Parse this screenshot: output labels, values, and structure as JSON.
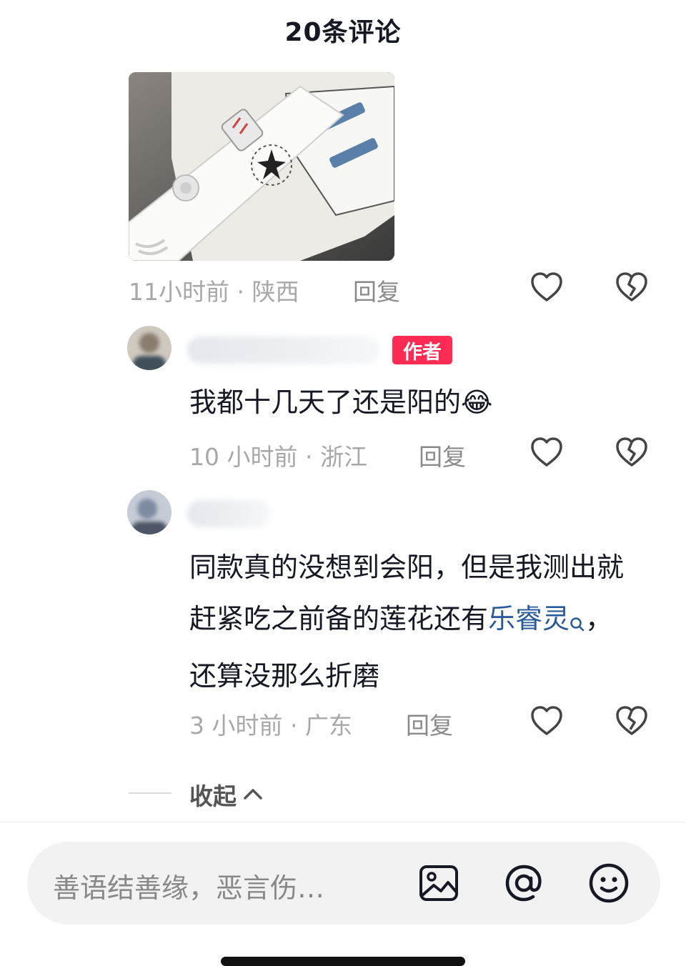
{
  "header": {
    "title": "20条评论"
  },
  "comments": [
    {
      "meta": "11小时前 · 陕西",
      "reply_label": "回复"
    },
    {
      "author_badge": "作者",
      "text": "我都十几天了还是阳的",
      "emoji": "😂",
      "meta": "10 小时前 · 浙江",
      "reply_label": "回复"
    },
    {
      "text_part1": "同款真的没想到会阳，但是我测出就赶紧吃之前备的莲花还有",
      "link_word": "乐睿灵",
      "text_part2": "，还算没那么折磨",
      "meta": "3 小时前 · 广东",
      "reply_label": "回复"
    }
  ],
  "collapse": {
    "label": "收起"
  },
  "input": {
    "placeholder": "善语结善缘，恶言伤…"
  },
  "icons": {
    "like": "heart-outline-icon",
    "dislike": "broken-heart-icon",
    "image": "image-icon",
    "mention": "at-icon",
    "emoji": "smiley-icon"
  },
  "colors": {
    "author_badge": "#fe2c55",
    "link": "#2a5a99",
    "meta": "#a8a8a8"
  }
}
